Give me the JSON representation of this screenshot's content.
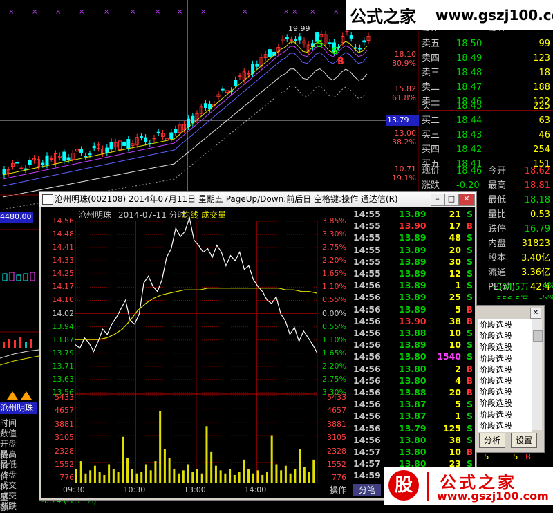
{
  "bg_chart": {
    "peak_label": "19.99",
    "s_markers": [
      "S",
      "S",
      "B"
    ],
    "price_levels": [
      {
        "price": "18.10",
        "pct": "80.9%"
      },
      {
        "price": "15.82",
        "pct": "61.8%"
      },
      {
        "price": "13.00",
        "pct": "38.2%"
      },
      {
        "price": "10.71",
        "pct": "19.1%"
      }
    ],
    "cursor_price": "13.79",
    "left_box_value": "4480.00",
    "stock_name_badge": "沧州明珠",
    "left_labels": [
      "时间",
      "数值",
      "开盘价",
      "最高价",
      "最低价",
      "收盘价",
      "成交量",
      "成交额",
      "涨跌"
    ],
    "bottom_status": "-0.24 (-1.71%)"
  },
  "orderbook": {
    "header_partial": [
      "委比",
      "委差"
    ],
    "sells": [
      {
        "label": "卖五",
        "price": "18.50",
        "vol": "99"
      },
      {
        "label": "卖四",
        "price": "18.49",
        "vol": "123"
      },
      {
        "label": "卖三",
        "price": "18.48",
        "vol": "18"
      },
      {
        "label": "卖二",
        "price": "18.47",
        "vol": "188"
      },
      {
        "label": "卖一",
        "price": "18.46",
        "vol": "122"
      }
    ],
    "buys": [
      {
        "label": "买一",
        "price": "18.45",
        "vol": "225"
      },
      {
        "label": "买二",
        "price": "18.44",
        "vol": "63"
      },
      {
        "label": "买三",
        "price": "18.43",
        "vol": "46"
      },
      {
        "label": "买四",
        "price": "18.42",
        "vol": "254"
      },
      {
        "label": "买五",
        "price": "18.41",
        "vol": "151"
      }
    ],
    "stats": [
      {
        "l1": "现价",
        "v1": "18.46",
        "l2": "今开",
        "v2": "18.62"
      },
      {
        "l1": "涨跌",
        "v1": "-0.20",
        "l2": "最高",
        "v2": "18.81"
      },
      {
        "l1": "%",
        "v1": "",
        "l2": "最低",
        "v2": "18.18"
      },
      {
        "l1": "9",
        "v1": "",
        "l2": "量比",
        "v2": "0.53"
      },
      {
        "l1": "3",
        "v1": "",
        "l2": "跌停",
        "v2": "16.79"
      },
      {
        "l1": "6",
        "v1": "",
        "l2": "内盘",
        "v2": "31823"
      },
      {
        "l1": "%",
        "v1": "",
        "l2": "股本",
        "v2": "3.40亿"
      },
      {
        "l1": "5",
        "v1": "",
        "l2": "流通",
        "v2": "3.36亿"
      },
      {
        "l1": "7",
        "v1": "",
        "l2": "PE(动)",
        "v2": "42.4"
      }
    ],
    "flow_row": {
      "a": "-504.5万",
      "b": "-4%"
    },
    "flow_row2": {
      "a": "-556.5万",
      "b": "-5%"
    }
  },
  "logo": {
    "top_cn": "公式之家",
    "top_url": "www.gszj100.com",
    "bottom_icon": "股",
    "bottom_cn": "公式之家",
    "bottom_url": "www.gszj100.com"
  },
  "popup": {
    "title": "沧州明珠(002108) 2014年07月11日 星期五 PageUp/Down:前后日 空格键:操作 通达信(R)",
    "sub_name": "沧州明珠",
    "sub_date": "2014-07-11 分时",
    "legend_avg": "均线",
    "legend_vol": "成交量",
    "price_axis": [
      "14.56",
      "14.48",
      "14.41",
      "14.33",
      "14.25",
      "14.17",
      "14.10",
      "14.02",
      "13.94",
      "13.87",
      "13.79",
      "13.71",
      "13.63",
      "13.56"
    ],
    "pct_axis": [
      "3.85%",
      "3.30%",
      "2.75%",
      "2.20%",
      "1.65%",
      "1.10%",
      "0.55%",
      "0.00%",
      "0.55%",
      "1.10%",
      "1.65%",
      "2.20%",
      "2.75%",
      "3.30%"
    ],
    "vol_axis": [
      "5433",
      "4657",
      "3881",
      "3105",
      "2328",
      "1552",
      "776"
    ],
    "time_axis": [
      "09:30",
      "10:30",
      "13:00",
      "14:00"
    ],
    "tabs": [
      "操作",
      "分笔"
    ],
    "ticks": [
      {
        "t": "14:55",
        "p": "13.89",
        "q": "21",
        "d": "S"
      },
      {
        "t": "14:55",
        "p": "13.90",
        "q": "17",
        "d": "B"
      },
      {
        "t": "14:55",
        "p": "13.89",
        "q": "48",
        "d": "S"
      },
      {
        "t": "14:55",
        "p": "13.89",
        "q": "20",
        "d": "S"
      },
      {
        "t": "14:55",
        "p": "13.89",
        "q": "30",
        "d": "S"
      },
      {
        "t": "14:55",
        "p": "13.89",
        "q": "12",
        "d": "S"
      },
      {
        "t": "14:56",
        "p": "13.89",
        "q": "1",
        "d": "S"
      },
      {
        "t": "14:56",
        "p": "13.89",
        "q": "25",
        "d": "S"
      },
      {
        "t": "14:56",
        "p": "13.89",
        "q": "5",
        "d": "B"
      },
      {
        "t": "14:56",
        "p": "13.90",
        "q": "38",
        "d": "B"
      },
      {
        "t": "14:56",
        "p": "13.88",
        "q": "10",
        "d": "S"
      },
      {
        "t": "14:56",
        "p": "13.89",
        "q": "10",
        "d": "S"
      },
      {
        "t": "14:56",
        "p": "13.80",
        "q": "1540",
        "d": "S"
      },
      {
        "t": "14:56",
        "p": "13.80",
        "q": "2",
        "d": "B"
      },
      {
        "t": "14:56",
        "p": "13.80",
        "q": "4",
        "d": "B"
      },
      {
        "t": "14:56",
        "p": "13.88",
        "q": "20",
        "d": "B"
      },
      {
        "t": "14:56",
        "p": "13.87",
        "q": "5",
        "d": "S"
      },
      {
        "t": "14:56",
        "p": "13.87",
        "q": "1",
        "d": "S"
      },
      {
        "t": "14:56",
        "p": "13.79",
        "q": "125",
        "d": "S"
      },
      {
        "t": "14:56",
        "p": "13.80",
        "q": "38",
        "d": "S"
      },
      {
        "t": "14:57",
        "p": "13.80",
        "q": "10",
        "d": "B"
      },
      {
        "t": "14:57",
        "p": "13.80",
        "q": "23",
        "d": "S"
      },
      {
        "t": "14:59",
        "p": "13.80",
        "q": "",
        "d": ""
      }
    ],
    "chart_data": {
      "type": "line",
      "series": [
        {
          "values": [
            13.84,
            13.82,
            13.88,
            13.85,
            13.8,
            13.86,
            13.93,
            13.9,
            13.96,
            14.0,
            14.05,
            14.1,
            13.98,
            13.96,
            14.02,
            14.2,
            14.24,
            14.18,
            14.15,
            14.22,
            14.35,
            14.4,
            14.52,
            14.47,
            14.5,
            14.58,
            14.45,
            14.42,
            14.38,
            14.4,
            14.35,
            14.42,
            14.38,
            14.3,
            14.36,
            14.33,
            14.38,
            14.28,
            14.3,
            14.22,
            14.18,
            14.15,
            14.1,
            14.08,
            14.12,
            14.02,
            13.98,
            13.9,
            13.94,
            13.86,
            13.92,
            13.88,
            13.84,
            13.79
          ]
        },
        {
          "values": [
            13.87,
            13.87,
            13.87,
            13.87,
            13.88,
            13.9,
            13.93,
            13.98,
            14.04,
            14.08,
            14.11,
            14.13,
            14.14,
            14.15,
            14.16,
            14.16,
            14.16,
            14.17,
            14.17,
            14.17,
            14.17,
            14.17,
            14.17,
            14.17,
            14.17,
            14.17,
            14.17,
            14.16,
            14.16,
            14.15,
            14.15,
            14.14
          ]
        }
      ],
      "volume": [
        900,
        1400,
        600,
        800,
        1100,
        700,
        500,
        1200,
        900,
        700,
        3000,
        1600,
        900,
        600,
        700,
        1200,
        800,
        1400,
        4700,
        2200,
        1600,
        900,
        600,
        800,
        1200,
        700,
        900,
        600,
        3700,
        2000,
        1100,
        800,
        600,
        900,
        500,
        700,
        1500,
        900,
        600,
        800,
        500,
        700,
        3100,
        1200,
        800,
        1100,
        600,
        900,
        2200,
        1000,
        700,
        1500
      ],
      "ylim": [
        13.56,
        14.56
      ]
    }
  },
  "dialog": {
    "items": [
      "阶段选股",
      "阶段选股",
      "阶段选股",
      "阶段选股",
      "阶段选股",
      "阶段选股",
      "阶段选股",
      "阶段选股",
      "阶段选股",
      "阶段选股"
    ],
    "btn_analyze": "分析",
    "btn_settings": "设置",
    "overflow_row": {
      "a": "5",
      "b": "5",
      "c": "B"
    }
  }
}
